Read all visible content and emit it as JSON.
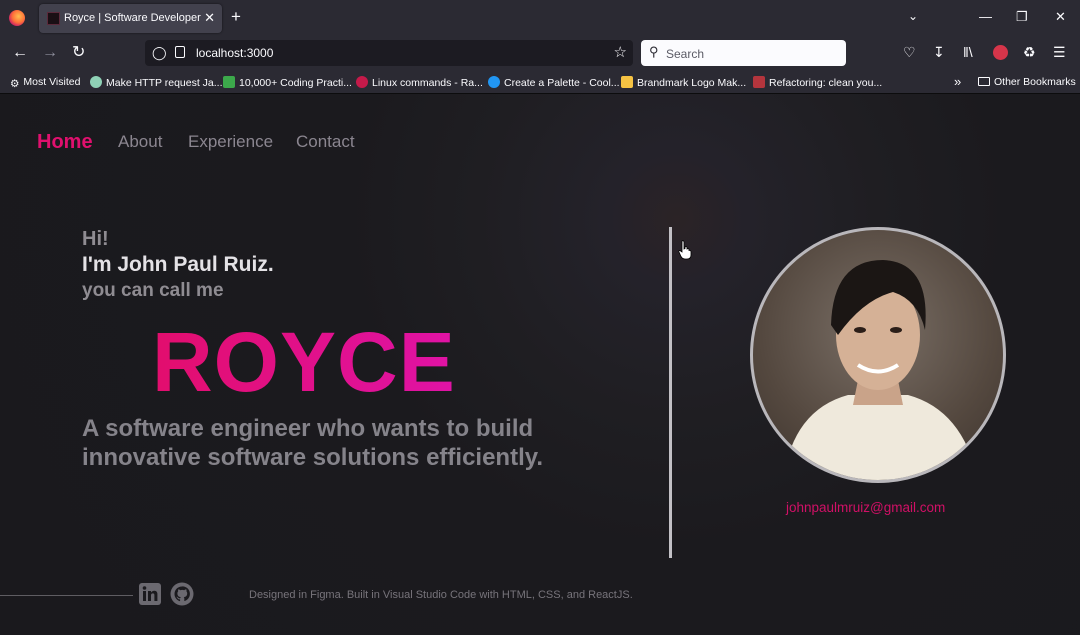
{
  "browser": {
    "tab_title": "Royce | Software Developer",
    "tab_close": "✕",
    "new_tab": "+",
    "url": "localhost:3000",
    "search_placeholder": "Search",
    "window_controls": {
      "minimize": "—",
      "maximize": "❐",
      "close": "✕"
    },
    "bookmarks": [
      {
        "label": "Most Visited",
        "icon": "gear-icon",
        "color": "#fbfbfe"
      },
      {
        "label": "Make HTTP request Ja...",
        "icon": "globe-icon",
        "color": "#8fd1b6"
      },
      {
        "label": "10,000+ Coding Practi...",
        "icon": "code-icon",
        "color": "#3ca94b"
      },
      {
        "label": "Linux commands - Ra...",
        "icon": "raspberry-icon",
        "color": "#c51a4a"
      },
      {
        "label": "Create a Palette - Cool...",
        "icon": "palette-icon",
        "color": "#2196f3"
      },
      {
        "label": "Brandmark Logo Mak...",
        "icon": "brandmark-icon",
        "color": "#f6c343"
      },
      {
        "label": "Refactoring: clean you...",
        "icon": "refactor-icon",
        "color": "#b4353d"
      }
    ],
    "other_bookmarks": "Other Bookmarks"
  },
  "site": {
    "nav": [
      "Home",
      "About",
      "Experience",
      "Contact"
    ],
    "active_nav": "Home",
    "greeting": "Hi!",
    "intro": "I'm John Paul Ruiz.",
    "call_me": "you can call me",
    "nickname": "ROYCE",
    "tagline": "A software engineer who wants to build innovative software solutions efficiently.",
    "email": "johnpaulmruiz@gmail.com",
    "social": [
      "linkedin-icon",
      "github-icon"
    ],
    "credit": "Designed in Figma. Built in Visual Studio Code with HTML, CSS, and ReactJS.",
    "accent": "#e0106e"
  }
}
